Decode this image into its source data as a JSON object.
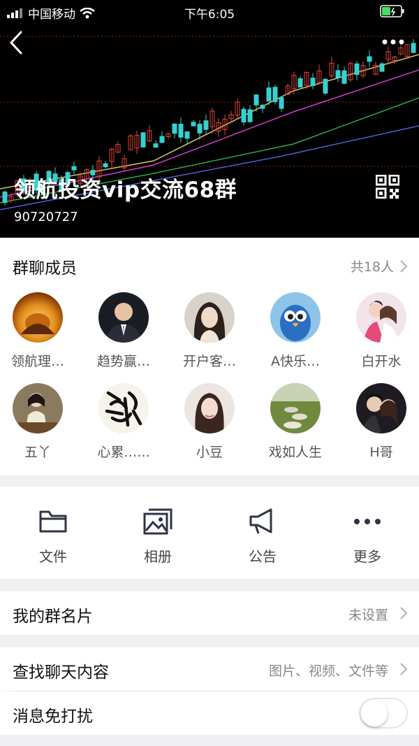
{
  "status_bar": {
    "carrier": "中国移动",
    "time": "下午6:05"
  },
  "header": {
    "group_name": "领航投资vip交流68群",
    "group_id": "90720727"
  },
  "members": {
    "title": "群聊成员",
    "count_label": "共18人",
    "list": [
      {
        "name": "领航理…",
        "avatar": "golden-dragon-avatar"
      },
      {
        "name": "趋势赢…",
        "avatar": "man-in-suit-avatar"
      },
      {
        "name": "开户客…",
        "avatar": "woman-portrait-avatar"
      },
      {
        "name": "A快乐…",
        "avatar": "blue-parrot-avatar"
      },
      {
        "name": "白开水",
        "avatar": "couple-photo-avatar"
      },
      {
        "name": "五丫",
        "avatar": "girl-sitting-avatar"
      },
      {
        "name": "心累.…..",
        "avatar": "calligraphy-avatar"
      },
      {
        "name": "小豆",
        "avatar": "woman-selfie-avatar"
      },
      {
        "name": "戏如人生",
        "avatar": "stone-path-avatar"
      },
      {
        "name": "H哥",
        "avatar": "couple-dark-avatar"
      }
    ]
  },
  "actions": [
    {
      "label": "文件",
      "icon": "folder-icon"
    },
    {
      "label": "相册",
      "icon": "photo-album-icon"
    },
    {
      "label": "公告",
      "icon": "megaphone-icon"
    },
    {
      "label": "更多",
      "icon": "more-dots-icon"
    }
  ],
  "rows": {
    "card": {
      "title": "我的群名片",
      "value": "未设置"
    },
    "search": {
      "title": "查找聊天内容",
      "value": "图片、视频、文件等"
    },
    "mute": {
      "title": "消息免打扰",
      "enabled": false
    }
  },
  "colors": {
    "accent": "#2f3445",
    "chart_up": "#e0443c",
    "chart_down": "#34d1d1"
  }
}
